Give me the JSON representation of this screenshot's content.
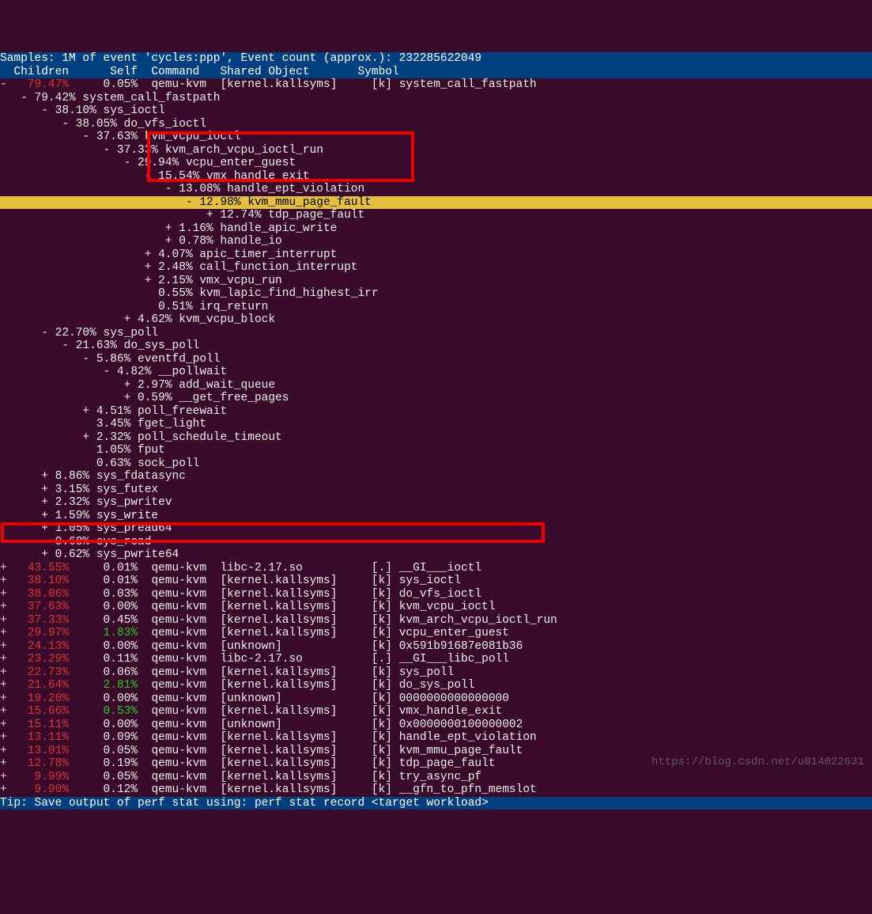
{
  "header1": "Samples: 1M of event 'cycles:ppp', Event count (approx.): 232285622049",
  "header2": "  Children      Self  Command   Shared Object       Symbol",
  "tip": "Tip: Save output of perf stat using: perf stat record <target workload>",
  "watermark": "https://blog.csdn.net/u014022631",
  "tree": [
    {
      "e": "-",
      "ch": "79.47%",
      "chc": "r",
      "self": "0.05%",
      "cmd": "qemu-kvm",
      "obj": "[kernel.kallsyms]",
      "sym": "[k] system_call_fastpath"
    },
    {
      "t": "   - 79.42% system_call_fastpath"
    },
    {
      "t": "      - 38.10% sys_ioctl"
    },
    {
      "t": "         - 38.05% do_vfs_ioctl"
    },
    {
      "t": "            - 37.63% kvm_vcpu_ioctl"
    },
    {
      "t": "               - 37.33% kvm_arch_vcpu_ioctl_run"
    },
    {
      "t": "                  - 29.94% vcpu_enter_guest"
    },
    {
      "t": "                     - 15.54% vmx_handle_exit"
    },
    {
      "t": "                        - 13.08% handle_ept_violation"
    },
    {
      "t": "                           - 12.98% kvm_mmu_page_fault",
      "hl": true
    },
    {
      "t": "                              + 12.74% tdp_page_fault"
    },
    {
      "t": "                        + 1.16% handle_apic_write"
    },
    {
      "t": "                        + 0.78% handle_io"
    },
    {
      "t": "                     + 4.07% apic_timer_interrupt"
    },
    {
      "t": "                     + 2.48% call_function_interrupt"
    },
    {
      "t": "                     + 2.15% vmx_vcpu_run"
    },
    {
      "t": "                       0.55% kvm_lapic_find_highest_irr"
    },
    {
      "t": "                       0.51% irq_return"
    },
    {
      "t": "                  + 4.62% kvm_vcpu_block"
    },
    {
      "t": "      - 22.70% sys_poll"
    },
    {
      "t": "         - 21.63% do_sys_poll"
    },
    {
      "t": "            - 5.86% eventfd_poll"
    },
    {
      "t": "               - 4.82% __pollwait"
    },
    {
      "t": "                  + 2.97% add_wait_queue"
    },
    {
      "t": "                  + 0.59% __get_free_pages"
    },
    {
      "t": "            + 4.51% poll_freewait"
    },
    {
      "t": "              3.45% fget_light"
    },
    {
      "t": "            + 2.32% poll_schedule_timeout"
    },
    {
      "t": "              1.05% fput"
    },
    {
      "t": "              0.63% sock_poll"
    },
    {
      "t": "      + 8.86% sys_fdatasync"
    },
    {
      "t": "      + 3.15% sys_futex"
    },
    {
      "t": "      + 2.32% sys_pwritev"
    },
    {
      "t": "      + 1.59% sys_write"
    },
    {
      "t": "      + 1.05% sys_pread64"
    },
    {
      "t": "        0.68% sys_read"
    },
    {
      "t": "      + 0.62% sys_pwrite64"
    }
  ],
  "flat": [
    {
      "e": "+",
      "ch": "43.55%",
      "chc": "r",
      "self": "0.01%",
      "sc": "w",
      "cmd": "qemu-kvm",
      "obj": "libc-2.17.so",
      "sym": "[.] __GI___ioctl"
    },
    {
      "e": "+",
      "ch": "38.10%",
      "chc": "r",
      "self": "0.01%",
      "sc": "w",
      "cmd": "qemu-kvm",
      "obj": "[kernel.kallsyms]",
      "sym": "[k] sys_ioctl"
    },
    {
      "e": "+",
      "ch": "38.06%",
      "chc": "r",
      "self": "0.03%",
      "sc": "w",
      "cmd": "qemu-kvm",
      "obj": "[kernel.kallsyms]",
      "sym": "[k] do_vfs_ioctl"
    },
    {
      "e": "+",
      "ch": "37.63%",
      "chc": "r",
      "self": "0.00%",
      "sc": "w",
      "cmd": "qemu-kvm",
      "obj": "[kernel.kallsyms]",
      "sym": "[k] kvm_vcpu_ioctl"
    },
    {
      "e": "+",
      "ch": "37.33%",
      "chc": "r",
      "self": "0.45%",
      "sc": "w",
      "cmd": "qemu-kvm",
      "obj": "[kernel.kallsyms]",
      "sym": "[k] kvm_arch_vcpu_ioctl_run"
    },
    {
      "e": "+",
      "ch": "29.97%",
      "chc": "r",
      "self": "1.83%",
      "sc": "g",
      "cmd": "qemu-kvm",
      "obj": "[kernel.kallsyms]",
      "sym": "[k] vcpu_enter_guest"
    },
    {
      "e": "+",
      "ch": "24.13%",
      "chc": "r",
      "self": "0.00%",
      "sc": "w",
      "cmd": "qemu-kvm",
      "obj": "[unknown]",
      "sym": "[k] 0x591b91687e081b36"
    },
    {
      "e": "+",
      "ch": "23.29%",
      "chc": "r",
      "self": "0.11%",
      "sc": "w",
      "cmd": "qemu-kvm",
      "obj": "libc-2.17.so",
      "sym": "[.] __GI___libc_poll"
    },
    {
      "e": "+",
      "ch": "22.73%",
      "chc": "r",
      "self": "0.06%",
      "sc": "w",
      "cmd": "qemu-kvm",
      "obj": "[kernel.kallsyms]",
      "sym": "[k] sys_poll"
    },
    {
      "e": "+",
      "ch": "21.64%",
      "chc": "r",
      "self": "2.81%",
      "sc": "g",
      "cmd": "qemu-kvm",
      "obj": "[kernel.kallsyms]",
      "sym": "[k] do_sys_poll"
    },
    {
      "e": "+",
      "ch": "19.20%",
      "chc": "r",
      "self": "0.00%",
      "sc": "w",
      "cmd": "qemu-kvm",
      "obj": "[unknown]",
      "sym": "[k] 0000000000000000"
    },
    {
      "e": "+",
      "ch": "15.66%",
      "chc": "r",
      "self": "0.53%",
      "sc": "g",
      "cmd": "qemu-kvm",
      "obj": "[kernel.kallsyms]",
      "sym": "[k] vmx_handle_exit"
    },
    {
      "e": "+",
      "ch": "15.11%",
      "chc": "r",
      "self": "0.00%",
      "sc": "w",
      "cmd": "qemu-kvm",
      "obj": "[unknown]",
      "sym": "[k] 0x0000000100000002"
    },
    {
      "e": "+",
      "ch": "13.11%",
      "chc": "r",
      "self": "0.09%",
      "sc": "w",
      "cmd": "qemu-kvm",
      "obj": "[kernel.kallsyms]",
      "sym": "[k] handle_ept_violation"
    },
    {
      "e": "+",
      "ch": "13.01%",
      "chc": "r",
      "self": "0.05%",
      "sc": "w",
      "cmd": "qemu-kvm",
      "obj": "[kernel.kallsyms]",
      "sym": "[k] kvm_mmu_page_fault"
    },
    {
      "e": "+",
      "ch": "12.78%",
      "chc": "r",
      "self": "0.19%",
      "sc": "w",
      "cmd": "qemu-kvm",
      "obj": "[kernel.kallsyms]",
      "sym": "[k] tdp_page_fault"
    },
    {
      "e": "+",
      "ch": "9.99%",
      "chc": "r",
      "self": "0.05%",
      "sc": "w",
      "cmd": "qemu-kvm",
      "obj": "[kernel.kallsyms]",
      "sym": "[k] try_async_pf"
    },
    {
      "e": "+",
      "ch": "9.90%",
      "chc": "r",
      "self": "0.12%",
      "sc": "w",
      "cmd": "qemu-kvm",
      "obj": "[kernel.kallsyms]",
      "sym": "[k] __gfn_to_pfn_memslot"
    }
  ]
}
